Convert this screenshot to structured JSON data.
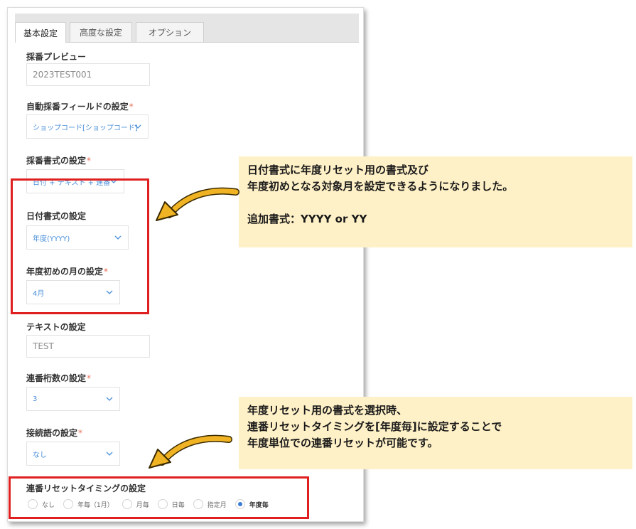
{
  "tabs": [
    {
      "label": "基本設定",
      "active": true
    },
    {
      "label": "高度な設定",
      "active": false
    },
    {
      "label": "オプション",
      "active": false
    }
  ],
  "fields": {
    "preview": {
      "label": "採番プレビュー",
      "value": "2023TEST001"
    },
    "auto_field": {
      "label": "自動採番フィールドの設定",
      "required": "*",
      "value": "ショップコード[ショップコード]"
    },
    "format": {
      "label": "採番書式の設定",
      "required": "*",
      "value": "日付 + テキスト + 連番"
    },
    "date_format": {
      "label": "日付書式の設定",
      "value": "年度(YYYY)"
    },
    "fiscal_month": {
      "label": "年度初めの月の設定",
      "required": "*",
      "value": "4月"
    },
    "text": {
      "label": "テキストの設定",
      "value": "TEST"
    },
    "digits": {
      "label": "連番桁数の設定",
      "required": "*",
      "value": "3"
    },
    "connector": {
      "label": "接続語の設定",
      "required": "*",
      "value": "なし"
    },
    "reset_timing": {
      "label": "連番リセットタイミングの設定",
      "options": [
        "なし",
        "年毎（1月）",
        "月毎",
        "日毎",
        "指定月",
        "年度毎"
      ],
      "selected_index": 5
    }
  },
  "callouts": {
    "top": {
      "lines": [
        "日付書式に年度リセット用の書式及び",
        "年度初めとなる対象月を設定できるようになりました。",
        "",
        "追加書式：YYYY or YY"
      ]
    },
    "bottom": {
      "lines": [
        "年度リセット用の書式を選択時、",
        "連番リセットタイミングを[年度毎]に設定することで",
        "年度単位での連番リセットが可能です。"
      ]
    }
  },
  "colors": {
    "highlight_border": "#e02020",
    "callout_bg": "#fff1c7",
    "arrow": "#f0b323",
    "select_text": "#4a8fd9",
    "required": "#e8725a",
    "radio_checked": "#3a7bd5"
  }
}
